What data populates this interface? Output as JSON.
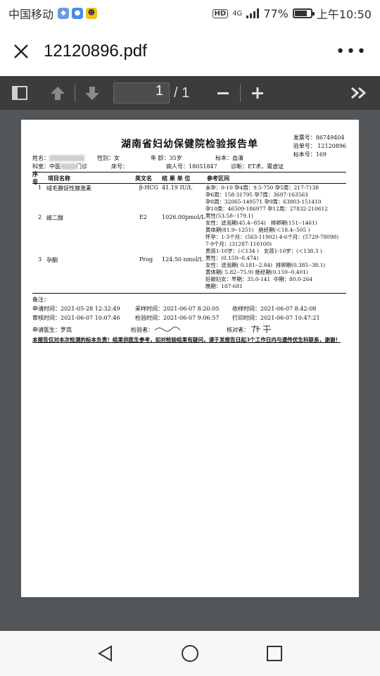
{
  "status_bar": {
    "carrier": "中国移动",
    "signal": "4G",
    "battery": "77%",
    "battery_level": 0.77,
    "time": "上午10:50"
  },
  "app": {
    "file_title": "12120896.pdf",
    "more_icon": "more-dots-icon"
  },
  "toolbar": {
    "current_page": "1",
    "total_pages": "/ 1"
  },
  "report": {
    "title": "湖南省妇幼保健院检验报告单",
    "codes": [
      "发票号：86749404",
      "验单号：  12120896",
      "标本号：169"
    ],
    "patient": {
      "name_label": "姓名：",
      "sex": "性别：女",
      "age": "年    龄：35岁",
      "specimen": "标本：血清",
      "dept": "科室：中医",
      "dept_suffix": "门诊",
      "bed": "床号：",
      "record": "病人号：18051847",
      "diagnosis": "诊断：ET术，胃虚证"
    },
    "columns": {
      "no": "序号",
      "name": "项目名称",
      "abbr": "英文名",
      "result": "结 果  单 位",
      "ref": "参考区间"
    },
    "items": [
      {
        "no": "1",
        "name": "绒毛膜促性腺激素",
        "abbr": "β-HCG",
        "result": "41.19  IU/L",
        "ref": "未孕：0-10 孕4周：9.5-750 孕5周：217-7138\n孕6周：158-31795 孕7周：3697-163563\n孕8周：32065-149571 孕9周：63803-151410\n孕10周：46509-186977 孕12周：27832-210612"
      },
      {
        "no": "2",
        "name": "雌二醇",
        "abbr": "E2",
        "result": "1026.00pmol/L",
        "ref": "男性(53.58--179.1)\n女性：滤泡期(45.4--854)   排卵期(151--1461)\n黄体期(81.9--1251)   绝经期(＜18.4--505 )\n怀孕：1-3个月：(563-11902) 4-6个月：(5729-78098)\n7-9个月：(31287-110100)\n男孩1-10岁：(＜134 )   女孩1-10岁：(＜138.3 )"
      },
      {
        "no": "3",
        "name": "孕酮",
        "abbr": "Prog",
        "result": "124.50 nmol/L",
        "ref": "男性：(0.159--0.474)\n女性：滤泡期( 0.181--2.84)  排卵期(0.385--38.1)\n黄体期( 5.82--75.9) 绝经期(0.159--0.401)\n妊娠妇女：早期：35.0-141  中期：80.0-264\n晚期：187-681"
      }
    ],
    "remarks_label": "备注：",
    "times": [
      [
        "申请时间：2021-05-28   12:32:49",
        "采样时间：2021-06-07  8:20:05",
        "收样时间：2021-06-07  8:42:08"
      ],
      [
        "审核时间：2021-06-07   10:07:46",
        "检验时间：2021-06-07   9:06:57",
        "打印时间：2021-06-07  10:47:21"
      ]
    ],
    "doctor": "申请医生：罗岚",
    "tester_label": "检验者：",
    "checker_label": "核对者：",
    "notice": "本报告仅对本次检测的标本负责！结果供医生参考，如对检验结果有疑问，请于发报告日起3个工作日内与遗传优生科联系，谢谢！"
  },
  "nav": {
    "back": "back-triangle-icon",
    "home": "home-circle-icon",
    "recents": "recents-square-icon"
  }
}
